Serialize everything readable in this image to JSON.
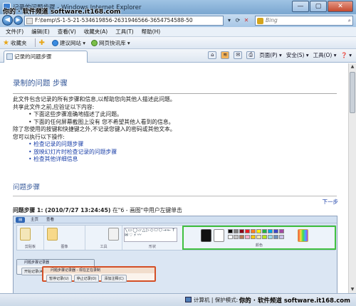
{
  "window": {
    "title": "记录的问题步骤 - Windows Internet Explorer",
    "buttons": {
      "min": "—",
      "max": "▢",
      "close": "✕"
    }
  },
  "address_bar": {
    "url": "F:\\temp\\S-1-5-21-534619856-2631946566-3654754588-50",
    "search_placeholder": "Bing",
    "search_icon": "search-icon"
  },
  "menu": [
    "文件(F)",
    "编辑(E)",
    "查看(V)",
    "收藏夹(A)",
    "工具(T)",
    "帮助(H)"
  ],
  "favorites_bar": {
    "favorites_label": "收藏夹",
    "items": [
      "建议网站 ▾",
      "网页快讯库 ▾"
    ]
  },
  "tab": {
    "label": "记录的问题步骤"
  },
  "command_bar": {
    "page": "页面(P) ▾",
    "safety": "安全(S) ▾",
    "tools": "工具(O) ▾",
    "help": "❓ ▾"
  },
  "report": {
    "title": "录制的问题 步骤",
    "intro_lines": [
      "此文件包含记录的所有步骤和信息,以帮助您向其他人描述此问题。",
      "共享此文件之前,应验证以下内容:"
    ],
    "checks": [
      "• 下面这些步骤准确地描述了此问题。",
      "• 下面的任何屏幕截图上没有 您不希望其他人看到的信息。"
    ],
    "privacy_line": "除了您使用的按键和快捷键之外,不记录您键入的密码或其他文本。",
    "can_do_line": "您可以执行以下操作:",
    "links": [
      "• 检查记录的问题步骤",
      "• 放映幻灯片时检查记录的问题步骤",
      "• 检查其他详细信息"
    ],
    "steps_heading": "问题步骤",
    "next_link": "下一步",
    "step1_label": "问题步骤 1: (2010/7/27 13:24:45)",
    "step1_desc": "在\"6 - 画图\"中用户左键单击"
  },
  "screenshot": {
    "tabs": [
      "主页",
      "查看"
    ],
    "groups": [
      "剪贴板",
      "图像",
      "工具",
      "形状",
      "颜色"
    ],
    "task_window_1": {
      "title": "问题步骤记录器",
      "button": "开始记录(A)"
    },
    "task_window_2": {
      "title": "问题步骤记录器 - 现在正在录制",
      "buttons": [
        "暂停记录(U)",
        "停止记录(O)",
        "添加注释(C)"
      ]
    }
  },
  "status": {
    "zone": "计算机 | 保护模式: 禁用"
  },
  "watermark": {
    "top": "你的 · 软件频道  software.it168.com",
    "bottom": "你的 · 软件频道  software.it168.com"
  }
}
